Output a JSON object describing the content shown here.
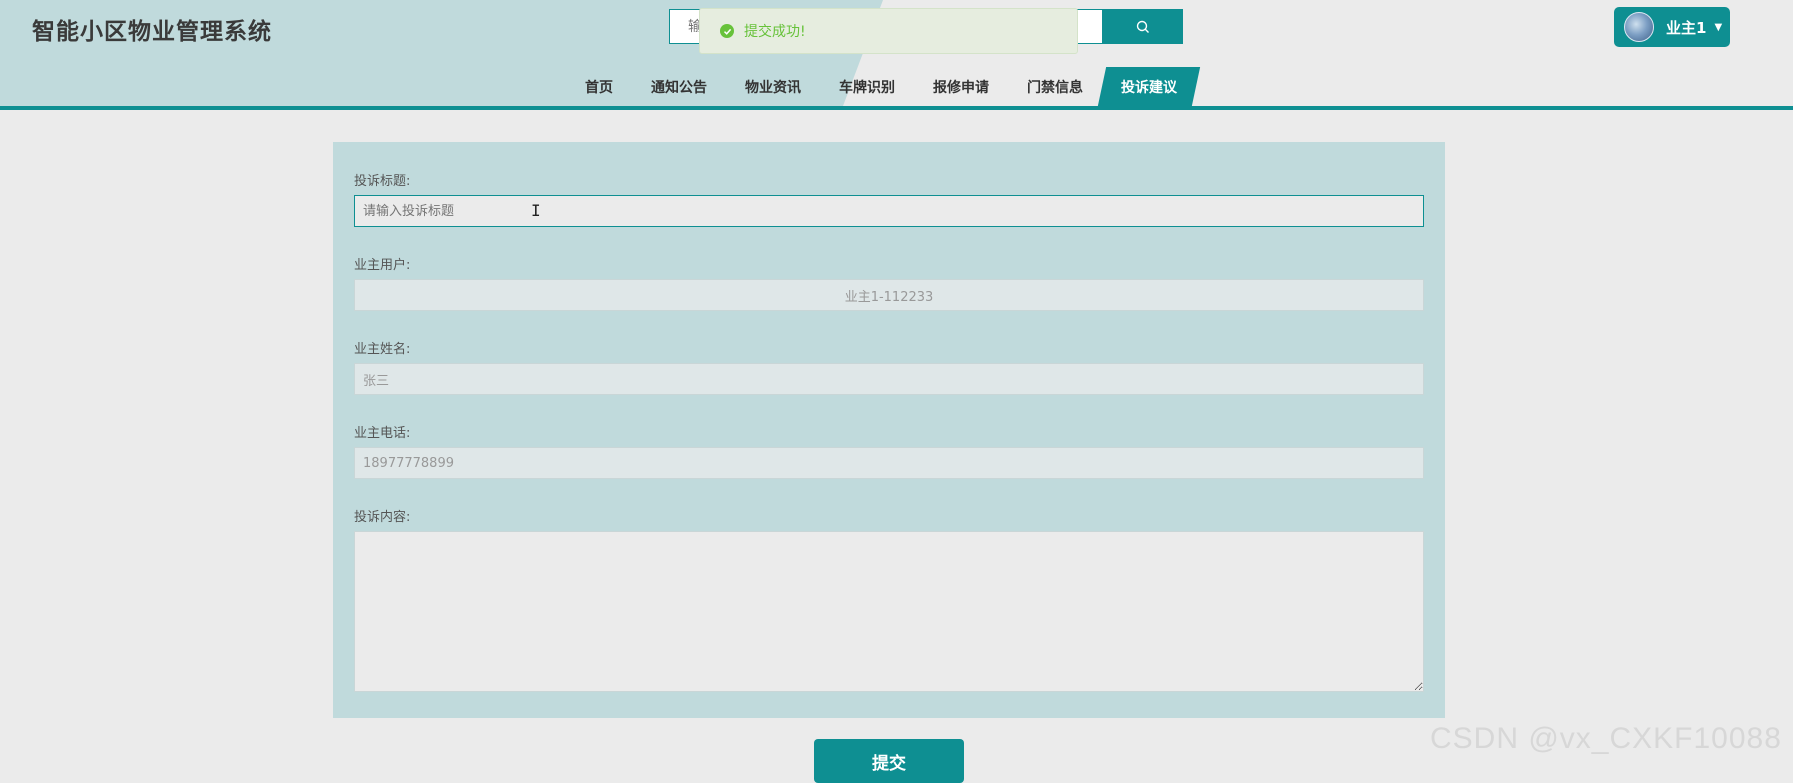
{
  "header": {
    "title": "智能小区物业管理系统",
    "search_placeholder": "输入关键词搜索",
    "user_name": "业主1"
  },
  "nav": {
    "items": [
      {
        "label": "首页"
      },
      {
        "label": "通知公告"
      },
      {
        "label": "物业资讯"
      },
      {
        "label": "车牌识别"
      },
      {
        "label": "报修申请"
      },
      {
        "label": "门禁信息"
      },
      {
        "label": "投诉建议",
        "active": true
      }
    ]
  },
  "toast": {
    "message": "提交成功!"
  },
  "form": {
    "title_label": "投诉标题:",
    "title_placeholder": "请输入投诉标题",
    "user_label": "业主用户:",
    "user_value": "业主1-112233",
    "name_label": "业主姓名:",
    "name_value": "张三",
    "phone_label": "业主电话:",
    "phone_value": "18977778899",
    "content_label": "投诉内容:",
    "submit_label": "提交"
  },
  "watermark": "CSDN @vx_CXKF10088",
  "colors": {
    "accent": "#0e8f92",
    "panel": "#c0dadc",
    "success": "#67c23a"
  }
}
